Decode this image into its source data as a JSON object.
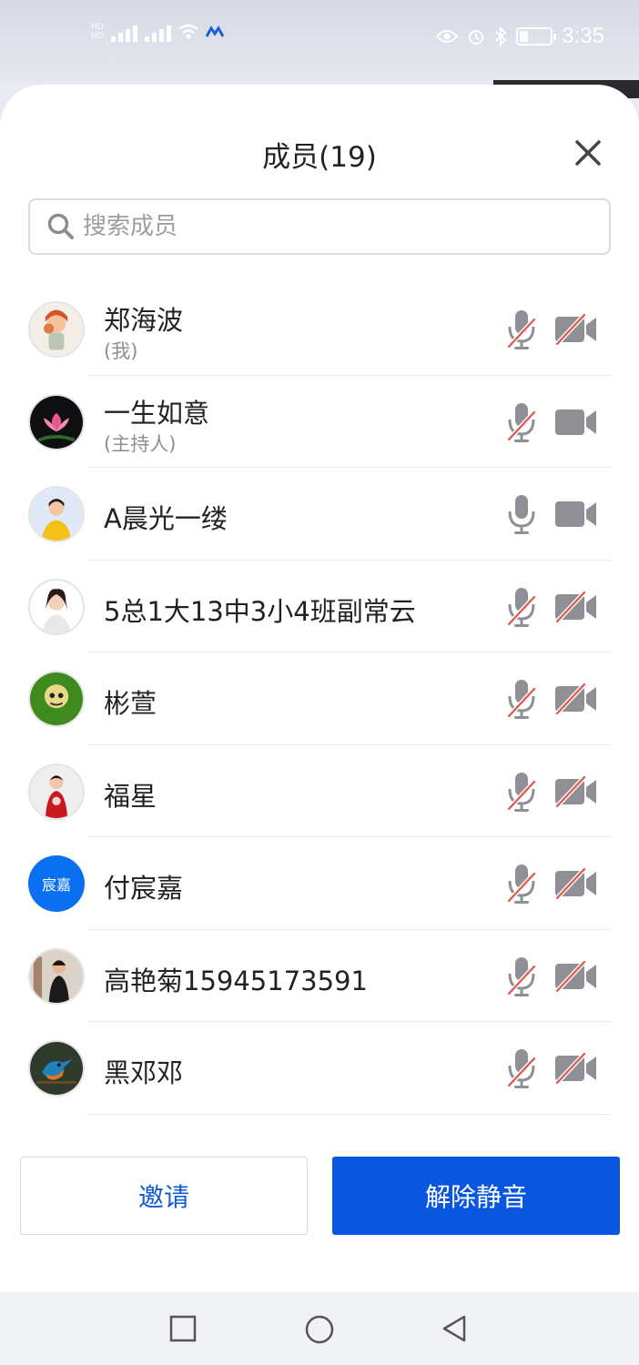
{
  "status_bar": {
    "time": "3:35",
    "battery_percent": 25
  },
  "dialog": {
    "title": "成员(19)",
    "search_placeholder": "搜索成员"
  },
  "members": [
    {
      "name": "郑海波",
      "sub": "(我)",
      "mic_muted": true,
      "cam_off": true,
      "avatar": "cartoon-girl"
    },
    {
      "name": "一生如意",
      "sub": "(主持人)",
      "mic_muted": true,
      "cam_off": false,
      "avatar": "lotus"
    },
    {
      "name": "A晨光一缕",
      "sub": "",
      "mic_muted": false,
      "cam_off": false,
      "avatar": "woman-yellow"
    },
    {
      "name": "5总1大13中3小4班副常云",
      "sub": "",
      "mic_muted": true,
      "cam_off": true,
      "avatar": "woman-portrait"
    },
    {
      "name": "彬萱",
      "sub": "",
      "mic_muted": true,
      "cam_off": true,
      "avatar": "green-portrait"
    },
    {
      "name": "福星",
      "sub": "",
      "mic_muted": true,
      "cam_off": true,
      "avatar": "woman-red"
    },
    {
      "name": "付宸嘉",
      "sub": "",
      "mic_muted": true,
      "cam_off": true,
      "avatar_text": "宸嘉",
      "avatar": "text"
    },
    {
      "name": "高艳菊15945173591",
      "sub": "",
      "mic_muted": true,
      "cam_off": true,
      "avatar": "woman-black"
    },
    {
      "name": "黑邓邓",
      "sub": "",
      "mic_muted": true,
      "cam_off": true,
      "avatar": "kingfisher"
    }
  ],
  "buttons": {
    "invite": "邀请",
    "unmute": "解除静音"
  },
  "colors": {
    "primary": "#0a56e0",
    "mute_slash": "#e0554c",
    "icon_gray": "#8f9095"
  }
}
